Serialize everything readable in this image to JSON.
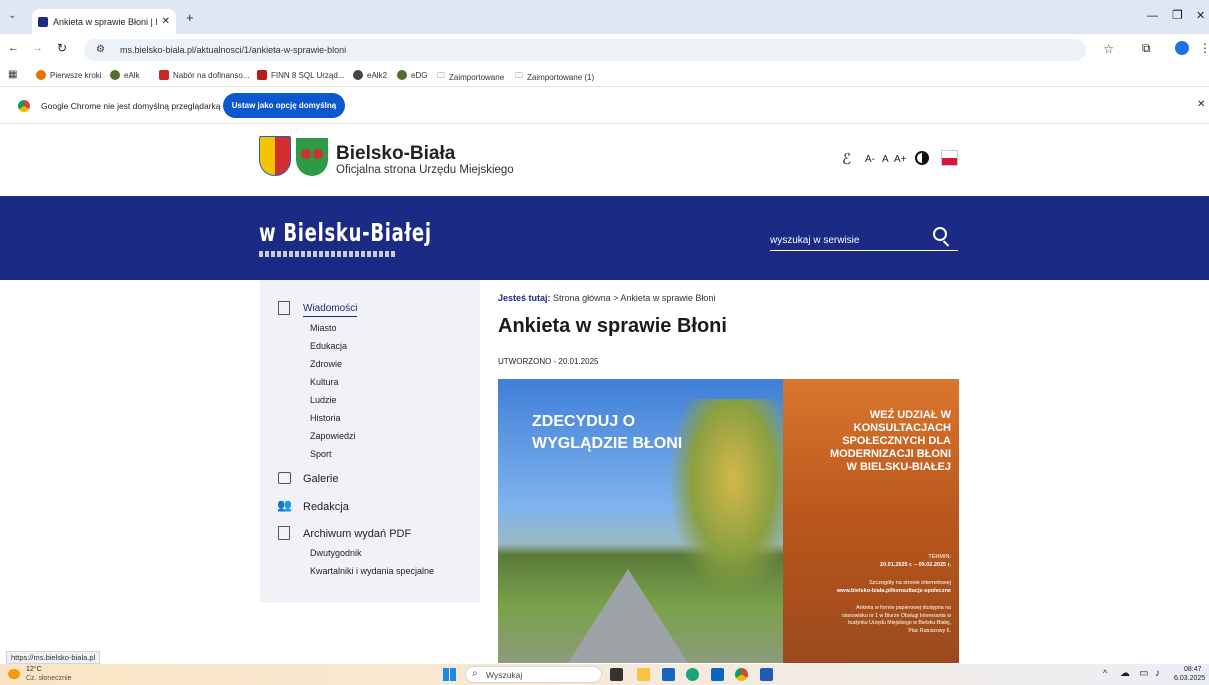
{
  "browser": {
    "tab_title": "Ankieta w sprawie Błoni | Maga",
    "new_tab_symbol": "+",
    "url": "ms.bielsko-biala.pl/aktualnosci/1/ankieta-w-sprawie-bloni",
    "bookmarks": [
      "Pierwsze kroki",
      "eAlk",
      "Nabór na dofinanso...",
      "FINN 8 SQL Urząd...",
      "eAlk2",
      "eDG",
      "Zaimportowane",
      "Zaimportowane (1)"
    ],
    "infobar_text": "Google Chrome nie jest domyślną przeglądarką",
    "infobar_button": "Ustaw jako opcję domyślną",
    "status_url": "https://ms.bielsko-biala.pl"
  },
  "site": {
    "title": "Bielsko-Biała",
    "subtitle": "Oficjalna strona Urzędu Miejskiego",
    "a11y": {
      "a_minus": "A-",
      "a": "A",
      "a_plus": "A+"
    },
    "magazine_logo": "w Bielsku-Białej",
    "search_placeholder": "wyszukaj w serwisie"
  },
  "sidebar": {
    "news_label": "Wiadomości",
    "news_items": [
      "Miasto",
      "Edukacja",
      "Zdrowie",
      "Kultura",
      "Ludzie",
      "Historia",
      "Zapowiedzi",
      "Sport"
    ],
    "gallery_label": "Galerie",
    "editorial_label": "Redakcja",
    "archive_label": "Archiwum wydań PDF",
    "archive_items": [
      "Dwutygodnik",
      "Kwartalniki i wydania specjalne"
    ]
  },
  "article": {
    "breadcrumb_prefix": "Jesteś tutaj:",
    "breadcrumb_path": "Strona główna > Ankieta w sprawie Błoni",
    "title": "Ankieta w sprawie Błoni",
    "created": "UTWORZONO - 20.01.2025",
    "hero_left": [
      "ZDECYDUJ O",
      "WYGLĄDZIE BŁONI"
    ],
    "hero_right": [
      "WEŹ UDZIAŁ W",
      "KONSULTACJACH",
      "SPOŁECZNYCH DLA",
      "MODERNIZACJI BŁONI",
      "W BIELSKU-BIAŁEJ"
    ],
    "hero_term_label": "TERMIN:",
    "hero_term": "20.01.2025 r. – 09.02.2025 r.",
    "hero_details": "Szczegóły na stronie internetowej",
    "hero_url": "www.bielsko-biala.pl/konsultacje-spoleczne",
    "hero_paper": [
      "Ankieta w formie papierowej dostępna na",
      "stanowisku nr 1 w Biurze Obsługi Interesanta w",
      "budynku Urzędu Miejskiego w Bielsku-Białej,",
      "Plac Ratuszowy 6."
    ]
  },
  "taskbar": {
    "weather_temp": "12°C",
    "weather_desc": "Cz. słonecznie",
    "search": "Wyszukaj",
    "time": "08:47",
    "date": "6.03.2025"
  },
  "colors": {
    "banner": "#1b2a84",
    "accent": "#0b57d0",
    "hero_orange": "#c25a1f"
  }
}
